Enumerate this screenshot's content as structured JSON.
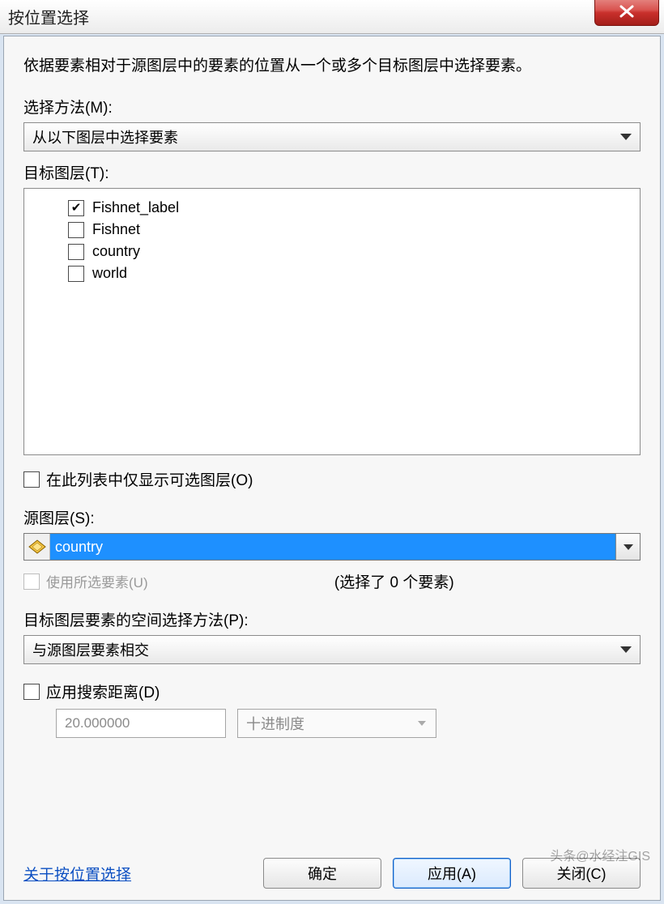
{
  "window": {
    "title": "按位置选择"
  },
  "intro": "依据要素相对于源图层中的要素的位置从一个或多个目标图层中选择要素。",
  "labels": {
    "method": "选择方法(M):",
    "target_layers": "目标图层(T):",
    "only_selectable": "在此列表中仅显示可选图层(O)",
    "source_layer": "源图层(S):",
    "use_selected": "使用所选要素(U)",
    "selected_count": "(选择了 0 个要素)",
    "spatial_method": "目标图层要素的空间选择方法(P):",
    "apply_distance": "应用搜索距离(D)"
  },
  "method": {
    "selected": "从以下图层中选择要素"
  },
  "target_layers": [
    {
      "name": "Fishnet_label",
      "checked": true
    },
    {
      "name": "Fishnet",
      "checked": false
    },
    {
      "name": "country",
      "checked": false
    },
    {
      "name": "world",
      "checked": false
    }
  ],
  "only_selectable_checked": false,
  "source": {
    "selected": "country"
  },
  "use_selected_checked": false,
  "spatial": {
    "selected": "与源图层要素相交"
  },
  "apply_distance_checked": false,
  "distance": {
    "value": "20.000000",
    "unit": "十进制度"
  },
  "help_link": "关于按位置选择",
  "buttons": {
    "ok": "确定",
    "apply": "应用(A)",
    "close": "关闭(C)"
  },
  "watermark": "头条@水经注GIS"
}
